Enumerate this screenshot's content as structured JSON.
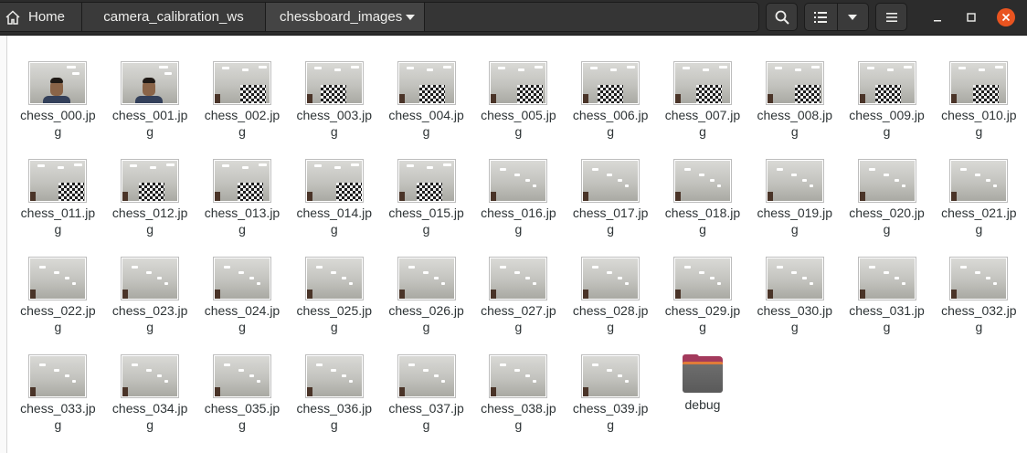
{
  "pathbar": {
    "home_label": "Home",
    "crumbs": [
      "camera_calibration_ws",
      "chessboard_images"
    ]
  },
  "header_icons": {
    "search": "search-icon",
    "view_list": "list-view-icon",
    "view_options": "chevron-down-icon",
    "menu": "hamburger-menu-icon",
    "minimize": "minimize-icon",
    "maximize": "maximize-icon",
    "close": "close-icon"
  },
  "colors": {
    "header_bg": "#2c2c2c",
    "close_button": "#e95420",
    "folder_accent": "#e07b39"
  },
  "files": [
    {
      "label": "chess_000.jpg",
      "kind": "face"
    },
    {
      "label": "chess_001.jpg",
      "kind": "face"
    },
    {
      "label": "chess_002.jpg",
      "kind": "board"
    },
    {
      "label": "chess_003.jpg",
      "kind": "board"
    },
    {
      "label": "chess_004.jpg",
      "kind": "board"
    },
    {
      "label": "chess_005.jpg",
      "kind": "board"
    },
    {
      "label": "chess_006.jpg",
      "kind": "board"
    },
    {
      "label": "chess_007.jpg",
      "kind": "board"
    },
    {
      "label": "chess_008.jpg",
      "kind": "board"
    },
    {
      "label": "chess_009.jpg",
      "kind": "board"
    },
    {
      "label": "chess_010.jpg",
      "kind": "board"
    },
    {
      "label": "chess_011.jpg",
      "kind": "board"
    },
    {
      "label": "chess_012.jpg",
      "kind": "board"
    },
    {
      "label": "chess_013.jpg",
      "kind": "board"
    },
    {
      "label": "chess_014.jpg",
      "kind": "board"
    },
    {
      "label": "chess_015.jpg",
      "kind": "board"
    },
    {
      "label": "chess_016.jpg",
      "kind": "ceiling"
    },
    {
      "label": "chess_017.jpg",
      "kind": "ceiling"
    },
    {
      "label": "chess_018.jpg",
      "kind": "ceiling"
    },
    {
      "label": "chess_019.jpg",
      "kind": "ceiling"
    },
    {
      "label": "chess_020.jpg",
      "kind": "ceiling"
    },
    {
      "label": "chess_021.jpg",
      "kind": "ceiling"
    },
    {
      "label": "chess_022.jpg",
      "kind": "ceiling"
    },
    {
      "label": "chess_023.jpg",
      "kind": "ceiling"
    },
    {
      "label": "chess_024.jpg",
      "kind": "ceiling"
    },
    {
      "label": "chess_025.jpg",
      "kind": "ceiling"
    },
    {
      "label": "chess_026.jpg",
      "kind": "ceiling"
    },
    {
      "label": "chess_027.jpg",
      "kind": "ceiling"
    },
    {
      "label": "chess_028.jpg",
      "kind": "ceiling"
    },
    {
      "label": "chess_029.jpg",
      "kind": "ceiling"
    },
    {
      "label": "chess_030.jpg",
      "kind": "ceiling"
    },
    {
      "label": "chess_031.jpg",
      "kind": "ceiling"
    },
    {
      "label": "chess_032.jpg",
      "kind": "ceiling"
    },
    {
      "label": "chess_033.jpg",
      "kind": "ceiling"
    },
    {
      "label": "chess_034.jpg",
      "kind": "ceiling"
    },
    {
      "label": "chess_035.jpg",
      "kind": "ceiling"
    },
    {
      "label": "chess_036.jpg",
      "kind": "ceiling"
    },
    {
      "label": "chess_037.jpg",
      "kind": "ceiling"
    },
    {
      "label": "chess_038.jpg",
      "kind": "ceiling"
    },
    {
      "label": "chess_039.jpg",
      "kind": "ceiling"
    }
  ],
  "folders": [
    {
      "label": "debug",
      "icon": "folder-icon"
    }
  ]
}
